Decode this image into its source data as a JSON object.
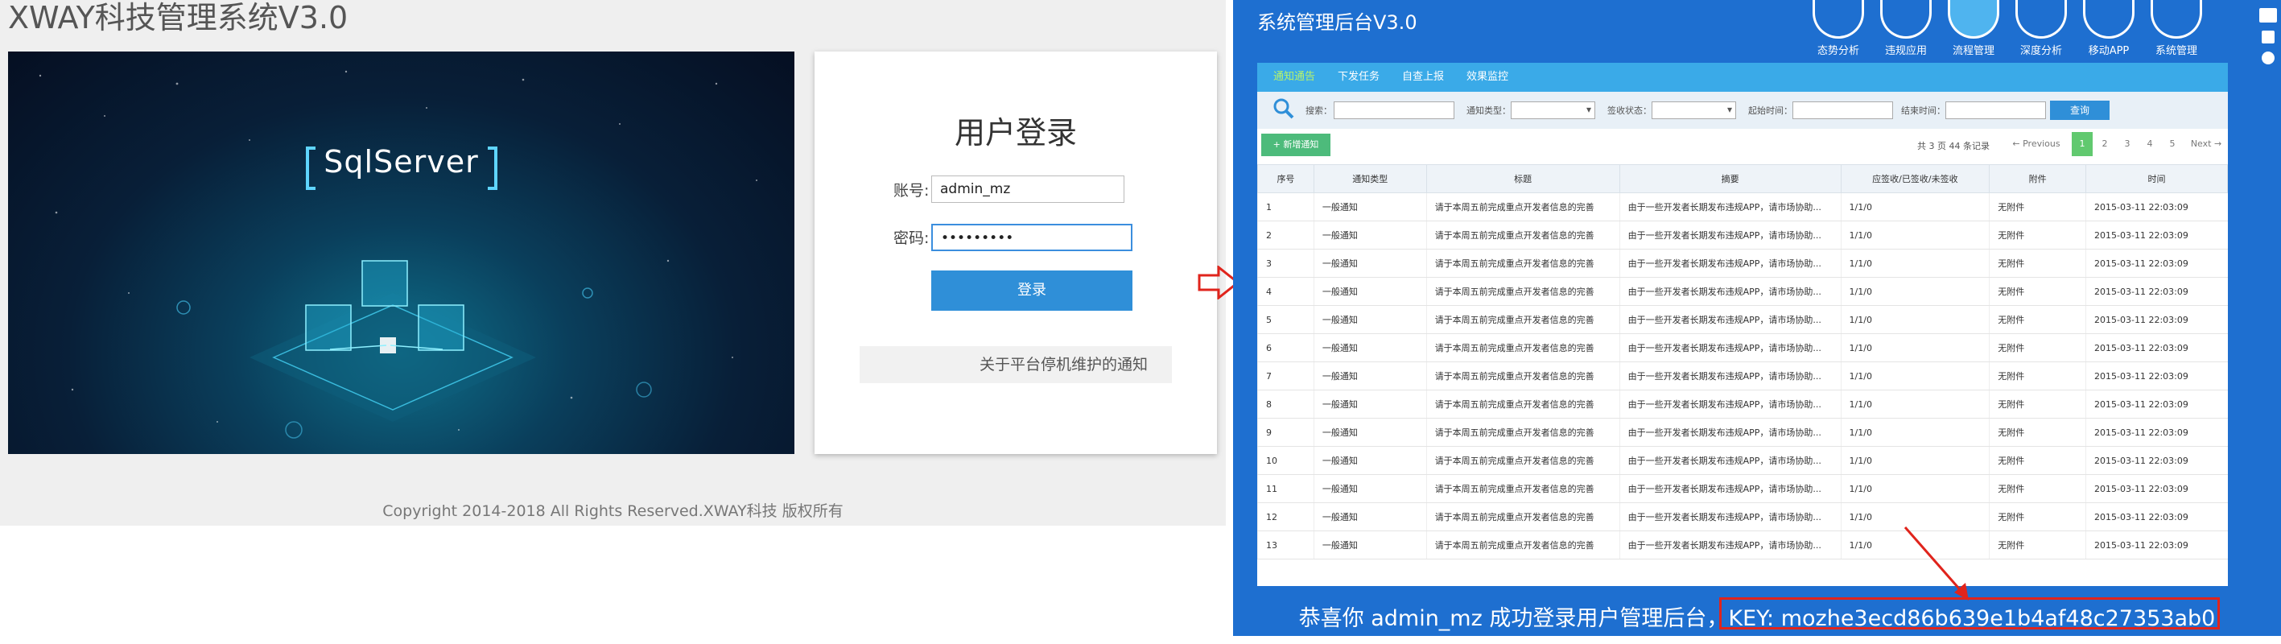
{
  "login_page": {
    "app_title": "XWAY科技管理系统V3.0",
    "product_name": "SqlServer",
    "heading": "用户登录",
    "account_label": "账号:",
    "account_value": "admin_mz",
    "password_label": "密码:",
    "password_value": "•••••••••",
    "login_button": "登录",
    "notice": "关于平台停机维护的通知",
    "copyright": "Copyright 2014-2018 All Rights Reserved.XWAY科技 版权所有"
  },
  "admin": {
    "title": "系统管理后台V3.0",
    "nav": [
      {
        "label": "态势分析"
      },
      {
        "label": "违规应用"
      },
      {
        "label": "流程管理"
      },
      {
        "label": "深度分析"
      },
      {
        "label": "移动APP"
      },
      {
        "label": "系统管理"
      }
    ],
    "active_nav": "流程管理",
    "subtabs": [
      "通知通告",
      "下发任务",
      "自查上报",
      "效果监控"
    ],
    "filters": {
      "search_label": "搜索：",
      "notice_type_label": "通知类型：",
      "receipt_status_label": "签收状态：",
      "start_time_label": "起始时间：",
      "end_time_label": "结束时间：",
      "query_button": "查询"
    },
    "add_button": "+ 新增通知",
    "pager": {
      "info": "共 3 页 44 条记录",
      "previous": "← Previous",
      "pages": [
        "1",
        "2",
        "3",
        "4",
        "5"
      ],
      "current_page": "1",
      "next": "Next →"
    },
    "table": {
      "headers": [
        "序号",
        "通知类型",
        "标题",
        "摘要",
        "应签收/已签收/未签收",
        "附件",
        "时间"
      ],
      "rows": [
        [
          "1",
          "一般通知",
          "请于本周五前完成重点开发者信息的完善",
          "由于一些开发者长期发布违规APP，请市场协助...",
          "1/1/0",
          "无附件",
          "2015-03-11 22:03:09"
        ],
        [
          "2",
          "一般通知",
          "请于本周五前完成重点开发者信息的完善",
          "由于一些开发者长期发布违规APP，请市场协助...",
          "1/1/0",
          "无附件",
          "2015-03-11 22:03:09"
        ],
        [
          "3",
          "一般通知",
          "请于本周五前完成重点开发者信息的完善",
          "由于一些开发者长期发布违规APP，请市场协助...",
          "1/1/0",
          "无附件",
          "2015-03-11 22:03:09"
        ],
        [
          "4",
          "一般通知",
          "请于本周五前完成重点开发者信息的完善",
          "由于一些开发者长期发布违规APP，请市场协助...",
          "1/1/0",
          "无附件",
          "2015-03-11 22:03:09"
        ],
        [
          "5",
          "一般通知",
          "请于本周五前完成重点开发者信息的完善",
          "由于一些开发者长期发布违规APP，请市场协助...",
          "1/1/0",
          "无附件",
          "2015-03-11 22:03:09"
        ],
        [
          "6",
          "一般通知",
          "请于本周五前完成重点开发者信息的完善",
          "由于一些开发者长期发布违规APP，请市场协助...",
          "1/1/0",
          "无附件",
          "2015-03-11 22:03:09"
        ],
        [
          "7",
          "一般通知",
          "请于本周五前完成重点开发者信息的完善",
          "由于一些开发者长期发布违规APP，请市场协助...",
          "1/1/0",
          "无附件",
          "2015-03-11 22:03:09"
        ],
        [
          "8",
          "一般通知",
          "请于本周五前完成重点开发者信息的完善",
          "由于一些开发者长期发布违规APP，请市场协助...",
          "1/1/0",
          "无附件",
          "2015-03-11 22:03:09"
        ],
        [
          "9",
          "一般通知",
          "请于本周五前完成重点开发者信息的完善",
          "由于一些开发者长期发布违规APP，请市场协助...",
          "1/1/0",
          "无附件",
          "2015-03-11 22:03:09"
        ],
        [
          "10",
          "一般通知",
          "请于本周五前完成重点开发者信息的完善",
          "由于一些开发者长期发布违规APP，请市场协助...",
          "1/1/0",
          "无附件",
          "2015-03-11 22:03:09"
        ],
        [
          "11",
          "一般通知",
          "请于本周五前完成重点开发者信息的完善",
          "由于一些开发者长期发布违规APP，请市场协助...",
          "1/1/0",
          "无附件",
          "2015-03-11 22:03:09"
        ],
        [
          "12",
          "一般通知",
          "请于本周五前完成重点开发者信息的完善",
          "由于一些开发者长期发布违规APP，请市场协助...",
          "1/1/0",
          "无附件",
          "2015-03-11 22:03:09"
        ],
        [
          "13",
          "一般通知",
          "请于本周五前完成重点开发者信息的完善",
          "由于一些开发者长期发布违规APP，请市场协助...",
          "1/1/0",
          "无附件",
          "2015-03-11 22:03:09"
        ]
      ]
    },
    "success_message": "恭喜你 admin_mz 成功登录用户管理后台，KEY:  mozhe3ecd86b639e1b4af48c27353ab0"
  },
  "colors": {
    "admin_bg": "#1e6fd0",
    "accent_blue": "#2f8fd8",
    "highlight_red": "#e0241c",
    "active_green": "#61c96f"
  },
  "icons": [
    "search-icon",
    "arrow-right-icon",
    "pointer-arrow-icon",
    "mail-icon",
    "lock-icon",
    "power-icon"
  ]
}
